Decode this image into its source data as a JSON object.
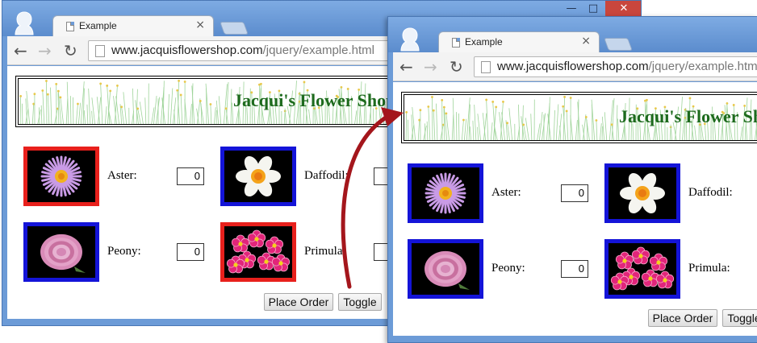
{
  "browser": {
    "tab_title": "Example",
    "tab_close_glyph": "×",
    "url_host": "www.jacquisflowershop.com",
    "url_path": "/jquery/example.html",
    "back_glyph": "←",
    "forward_glyph": "→",
    "reload_glyph": "↻",
    "minimize_glyph": "—",
    "maximize_glyph": "□",
    "close_glyph": "✕"
  },
  "page": {
    "banner_title": "Jacqui's Flower Shop",
    "flowers": [
      {
        "label": "Aster:",
        "quantity": "0",
        "icon": "aster-image"
      },
      {
        "label": "Daffodil:",
        "quantity": "0",
        "icon": "daffodil-image"
      },
      {
        "label": "Peony:",
        "quantity": "0",
        "icon": "peony-image"
      },
      {
        "label": "Primula:",
        "quantity": "0",
        "icon": "primula-image"
      }
    ],
    "buttons": {
      "place_order": "Place Order",
      "toggle": "Toggle"
    }
  },
  "before": {
    "border_colors": [
      "#e8201c",
      "#1414d8",
      "#1414d8",
      "#e8201c"
    ]
  },
  "after": {
    "border_colors": [
      "#1414d8",
      "#1414d8",
      "#1414d8",
      "#1414d8"
    ]
  },
  "colors": {
    "titlebar": "#6c9bd7",
    "banner_text": "#1d6a1d",
    "arrow": "#a4161c"
  }
}
